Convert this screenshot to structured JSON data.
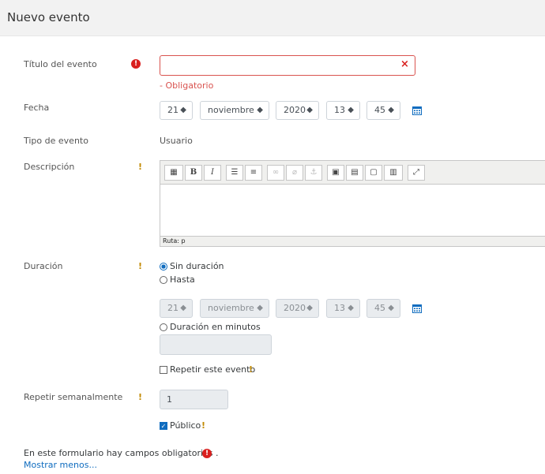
{
  "header": {
    "title": "Nuevo evento"
  },
  "fields": {
    "titulo": {
      "label": "Título del evento",
      "value": "",
      "error": "- Obligatorio",
      "clear_glyph": "×"
    },
    "fecha": {
      "label": "Fecha",
      "day": "21",
      "month": "noviembre",
      "year": "2020",
      "hour": "13",
      "minute": "45"
    },
    "tipo": {
      "label": "Tipo de evento",
      "value": "Usuario"
    },
    "descripcion": {
      "label": "Descripción",
      "status_path": "Ruta: p"
    },
    "duracion": {
      "label": "Duración",
      "options": [
        "Sin duración",
        "Hasta",
        "Duración en minutos"
      ],
      "selected": "Sin duración",
      "until": {
        "day": "21",
        "month": "noviembre",
        "year": "2020",
        "hour": "13",
        "minute": "45"
      },
      "minutes_value": ""
    },
    "repetir": {
      "label": "Repetir este evento",
      "checked": false
    },
    "repetir_semanal": {
      "label": "Repetir semanalmente",
      "value": "1"
    },
    "publico": {
      "label": "Público",
      "checked": true
    }
  },
  "footer": {
    "required_note": "En este formulario hay campos obligatorios",
    "required_suffix": ".",
    "show_less": "Mostrar menos..."
  },
  "icons": {
    "required": "!",
    "help": "!",
    "select_arrow": "◆",
    "check": "✓"
  },
  "colors": {
    "accent": "#0f6cbf",
    "error": "#d9201f",
    "help": "#c28a00"
  }
}
